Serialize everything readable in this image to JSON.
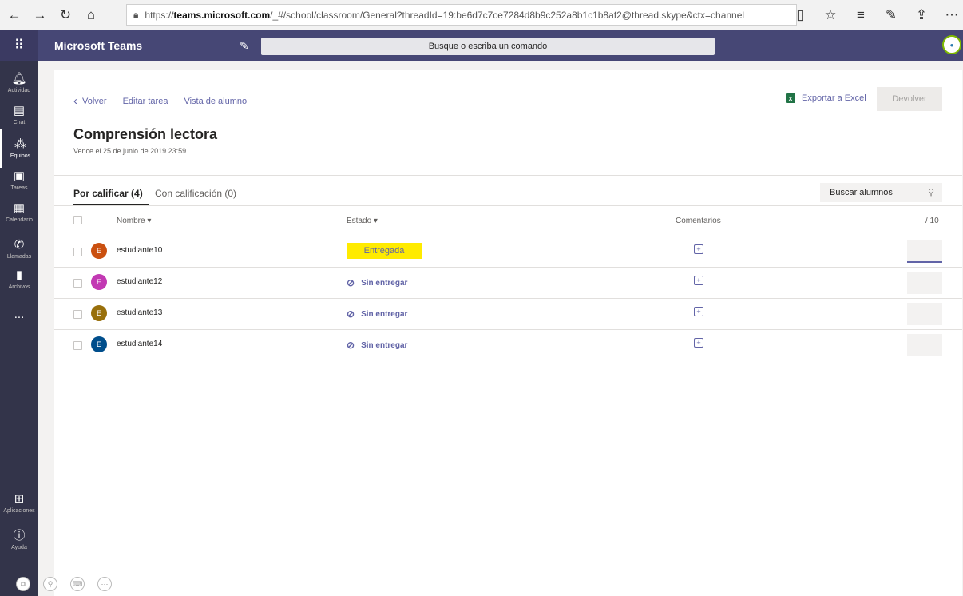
{
  "browser": {
    "url_prefix": "https://",
    "url_host": "teams.microsoft.com",
    "url_path": "/_#/school/classroom/General?threadId=19:be6d7c7ce7284d8b9c252a8b1c1b8af2@thread.skype&ctx=channel"
  },
  "app": {
    "title": "Microsoft Teams",
    "command_placeholder": "Busque o escriba un comando"
  },
  "rail": {
    "items": [
      {
        "label": "Actividad",
        "icon": "bell-icon"
      },
      {
        "label": "Chat",
        "icon": "chat-icon"
      },
      {
        "label": "Equipos",
        "icon": "teams-icon"
      },
      {
        "label": "Tareas",
        "icon": "assignments-icon"
      },
      {
        "label": "Calendario",
        "icon": "calendar-icon"
      },
      {
        "label": "Llamadas",
        "icon": "phone-icon"
      },
      {
        "label": "Archivos",
        "icon": "files-icon"
      },
      {
        "label": "...",
        "icon": "more-icon"
      }
    ],
    "apps_label": "Aplicaciones",
    "help_label": "Ayuda"
  },
  "toolbar": {
    "back_label": "Volver",
    "edit_label": "Editar tarea",
    "student_view_label": "Vista de alumno",
    "export_label": "Exportar a Excel",
    "return_label": "Devolver"
  },
  "assignment": {
    "title": "Comprensión lectora",
    "due": "Vence el 25 de junio de 2019 23:59"
  },
  "tabs": {
    "to_grade": "Por calificar (4)",
    "graded": "Con calificación (0)",
    "search_placeholder": "Buscar alumnos"
  },
  "columns": {
    "name": "Nombre",
    "status": "Estado",
    "comments": "Comentarios",
    "points": "/ 10"
  },
  "students": [
    {
      "initial": "E",
      "name": "estudiante10",
      "status": "Entregada",
      "avatar_color": "#ca5010"
    },
    {
      "initial": "E",
      "name": "estudiante12",
      "status": "Sin entregar",
      "avatar_color": "#c239b3"
    },
    {
      "initial": "E",
      "name": "estudiante13",
      "status": "Sin entregar",
      "avatar_color": "#986f0b"
    },
    {
      "initial": "E",
      "name": "estudiante14",
      "status": "Sin entregar",
      "avatar_color": "#004e8c"
    }
  ],
  "colors": {
    "teams_bar": "#464775",
    "rail": "#33344a",
    "accent": "#6264a7",
    "highlight": "#ffeb00"
  }
}
